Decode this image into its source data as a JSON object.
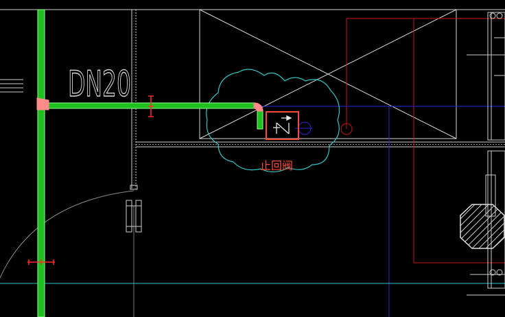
{
  "drawing": {
    "pipe_size_label": "DN20",
    "annotation_label": "止回阀"
  },
  "colors": {
    "background": "#000000",
    "pipe": "#1fbf1f",
    "pipe_edge": "#8dff8d",
    "fitting": "#ff8a8a",
    "wall": "#cfcfcf",
    "wall_fill": "#bdbdbd",
    "red_line": "#c41818",
    "blue_line": "#2a2ad8",
    "cyan_line": "#31c7c7",
    "highlight_box": "#ff4a3a",
    "annotation_text": "#ff4a3a",
    "dimension_marker": "#ff2a2a"
  }
}
